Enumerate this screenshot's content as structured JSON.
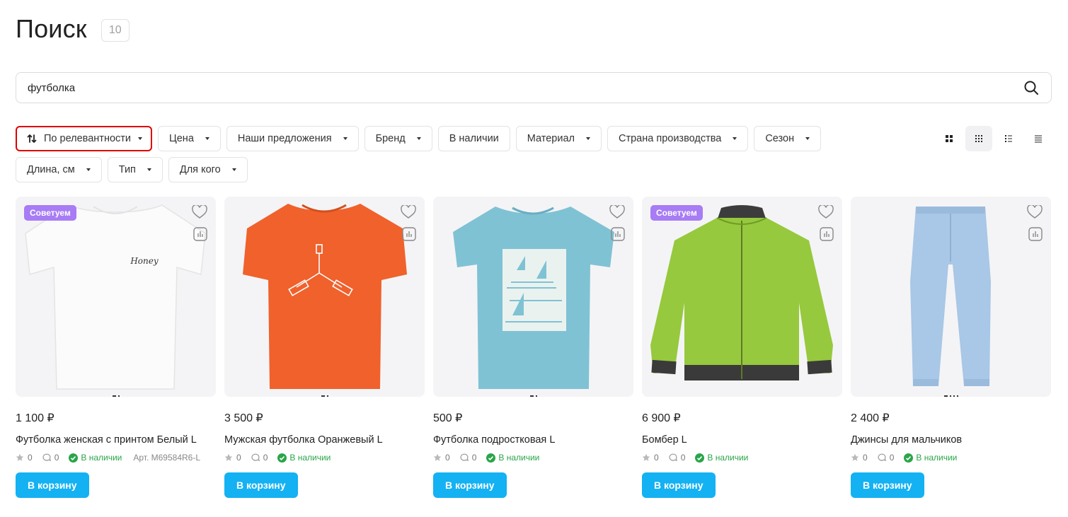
{
  "header": {
    "title": "Поиск",
    "count": "10"
  },
  "search": {
    "value": "футболка"
  },
  "sort": {
    "label": "По релевантности"
  },
  "filters": [
    {
      "label": "Цена"
    },
    {
      "label": "Наши предложения"
    },
    {
      "label": "Бренд"
    },
    {
      "label": "В наличии"
    },
    {
      "label": "Материал"
    },
    {
      "label": "Страна производства"
    },
    {
      "label": "Сезон"
    },
    {
      "label": "Длина, см"
    },
    {
      "label": "Тип"
    },
    {
      "label": "Для кого"
    }
  ],
  "view_modes": [
    "grid-large-icon",
    "grid-small-icon",
    "list-icon",
    "compact-list-icon"
  ],
  "products": [
    {
      "badge": "Советуем",
      "price": "1 100 ₽",
      "title": "Футболка женская с принтом Белый L",
      "rating": "0",
      "reviews": "0",
      "stock": "В наличии",
      "sku": "Арт. M69584R6-L",
      "image": "white-tshirt",
      "image_text": "Honey"
    },
    {
      "badge": "",
      "price": "3 500 ₽",
      "title": "Мужская футболка Оранжевый L",
      "rating": "0",
      "reviews": "0",
      "stock": "В наличии",
      "sku": "",
      "image": "orange-tshirt"
    },
    {
      "badge": "",
      "price": "500 ₽",
      "title": "Футболка подростковая L",
      "rating": "0",
      "reviews": "0",
      "stock": "В наличии",
      "sku": "",
      "image": "blue-tshirt"
    },
    {
      "badge": "Советуем",
      "price": "6 900 ₽",
      "title": "Бомбер L",
      "rating": "0",
      "reviews": "0",
      "stock": "В наличии",
      "sku": "",
      "image": "green-bomber"
    },
    {
      "badge": "",
      "price": "2 400 ₽",
      "title": "Джинсы для мальчиков",
      "rating": "0",
      "reviews": "0",
      "stock": "В наличии",
      "sku": "",
      "image": "jeans"
    }
  ],
  "cart_label": "В корзину",
  "colors": {
    "accent": "#14b1f3",
    "badge": "#a77cf5",
    "stock": "#2aa54a",
    "sort_border": "#e00000"
  }
}
